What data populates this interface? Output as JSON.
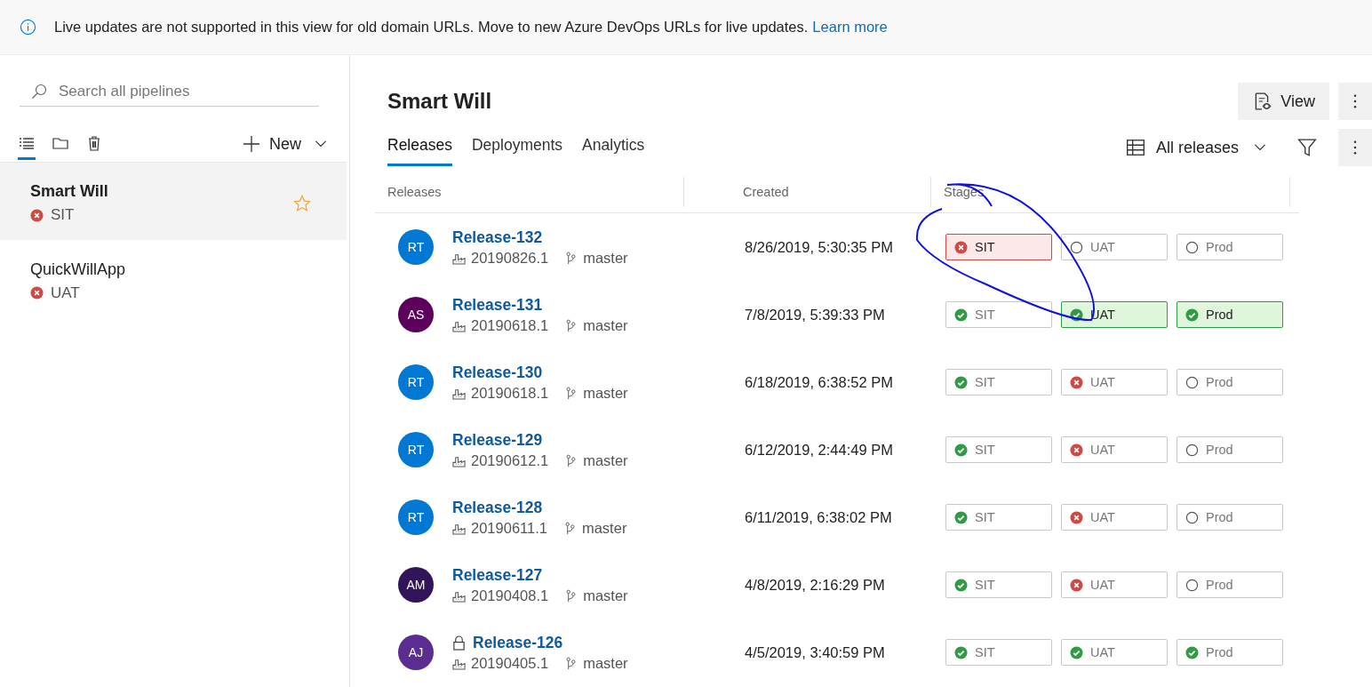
{
  "banner": {
    "text": "Live updates are not supported in this view for old domain URLs. Move to new Azure DevOps URLs for live updates.",
    "link": "Learn more"
  },
  "sidebar": {
    "search": {
      "placeholder": "Search all pipelines"
    },
    "view_tabs": [
      {
        "kind": "list",
        "selected": true
      },
      {
        "kind": "folder",
        "selected": false
      },
      {
        "kind": "trash",
        "selected": false
      }
    ],
    "new_button": "New",
    "items": [
      {
        "name": "Smart Will",
        "stage": "SIT",
        "selected": true,
        "starred": true
      },
      {
        "name": "QuickWillApp",
        "stage": "UAT",
        "selected": false,
        "starred": false
      }
    ]
  },
  "header": {
    "title": "Smart Will",
    "view_button": "View",
    "filter_label": "All releases",
    "tabs": [
      {
        "label": "Releases",
        "selected": true
      },
      {
        "label": "Deployments",
        "selected": false
      },
      {
        "label": "Analytics",
        "selected": false
      }
    ]
  },
  "table": {
    "columns": [
      "Releases",
      "Created",
      "Stages"
    ],
    "rows": [
      {
        "initials": "RT",
        "color": "#0078d4",
        "name": "Release-132",
        "locked": false,
        "build": "20190826.1",
        "branch": "master",
        "created": "8/26/2019, 5:30:35 PM",
        "stages": [
          {
            "name": "SIT",
            "kind": "failed",
            "highlighted": true
          },
          {
            "name": "UAT",
            "kind": "pending",
            "highlighted": false
          },
          {
            "name": "Prod",
            "kind": "pending",
            "highlighted": false
          }
        ]
      },
      {
        "initials": "AS",
        "color": "#5c005c",
        "name": "Release-131",
        "locked": false,
        "build": "20190618.1",
        "branch": "master",
        "created": "7/8/2019, 5:39:33 PM",
        "stages": [
          {
            "name": "SIT",
            "kind": "succeeded",
            "highlighted": false
          },
          {
            "name": "UAT",
            "kind": "succeeded",
            "highlighted": true
          },
          {
            "name": "Prod",
            "kind": "succeeded",
            "highlighted": true
          }
        ]
      },
      {
        "initials": "RT",
        "color": "#0078d4",
        "name": "Release-130",
        "locked": false,
        "build": "20190618.1",
        "branch": "master",
        "created": "6/18/2019, 6:38:52 PM",
        "stages": [
          {
            "name": "SIT",
            "kind": "succeeded",
            "highlighted": false
          },
          {
            "name": "UAT",
            "kind": "failed",
            "highlighted": false
          },
          {
            "name": "Prod",
            "kind": "pending",
            "highlighted": false
          }
        ]
      },
      {
        "initials": "RT",
        "color": "#0078d4",
        "name": "Release-129",
        "locked": false,
        "build": "20190612.1",
        "branch": "master",
        "created": "6/12/2019, 2:44:49 PM",
        "stages": [
          {
            "name": "SIT",
            "kind": "succeeded",
            "highlighted": false
          },
          {
            "name": "UAT",
            "kind": "failed",
            "highlighted": false
          },
          {
            "name": "Prod",
            "kind": "pending",
            "highlighted": false
          }
        ]
      },
      {
        "initials": "RT",
        "color": "#0078d4",
        "name": "Release-128",
        "locked": false,
        "build": "20190611.1",
        "branch": "master",
        "created": "6/11/2019, 6:38:02 PM",
        "stages": [
          {
            "name": "SIT",
            "kind": "succeeded",
            "highlighted": false
          },
          {
            "name": "UAT",
            "kind": "failed",
            "highlighted": false
          },
          {
            "name": "Prod",
            "kind": "pending",
            "highlighted": false
          }
        ]
      },
      {
        "initials": "AM",
        "color": "#32145a",
        "name": "Release-127",
        "locked": false,
        "build": "20190408.1",
        "branch": "master",
        "created": "4/8/2019, 2:16:29 PM",
        "stages": [
          {
            "name": "SIT",
            "kind": "succeeded",
            "highlighted": false
          },
          {
            "name": "UAT",
            "kind": "failed",
            "highlighted": false
          },
          {
            "name": "Prod",
            "kind": "pending",
            "highlighted": false
          }
        ]
      },
      {
        "initials": "AJ",
        "color": "#5c2d91",
        "name": "Release-126",
        "locked": true,
        "build": "20190405.1",
        "branch": "master",
        "created": "4/5/2019, 3:40:59 PM",
        "stages": [
          {
            "name": "SIT",
            "kind": "succeeded",
            "highlighted": false
          },
          {
            "name": "UAT",
            "kind": "succeeded",
            "highlighted": false
          },
          {
            "name": "Prod",
            "kind": "succeeded",
            "highlighted": false
          }
        ]
      }
    ]
  }
}
